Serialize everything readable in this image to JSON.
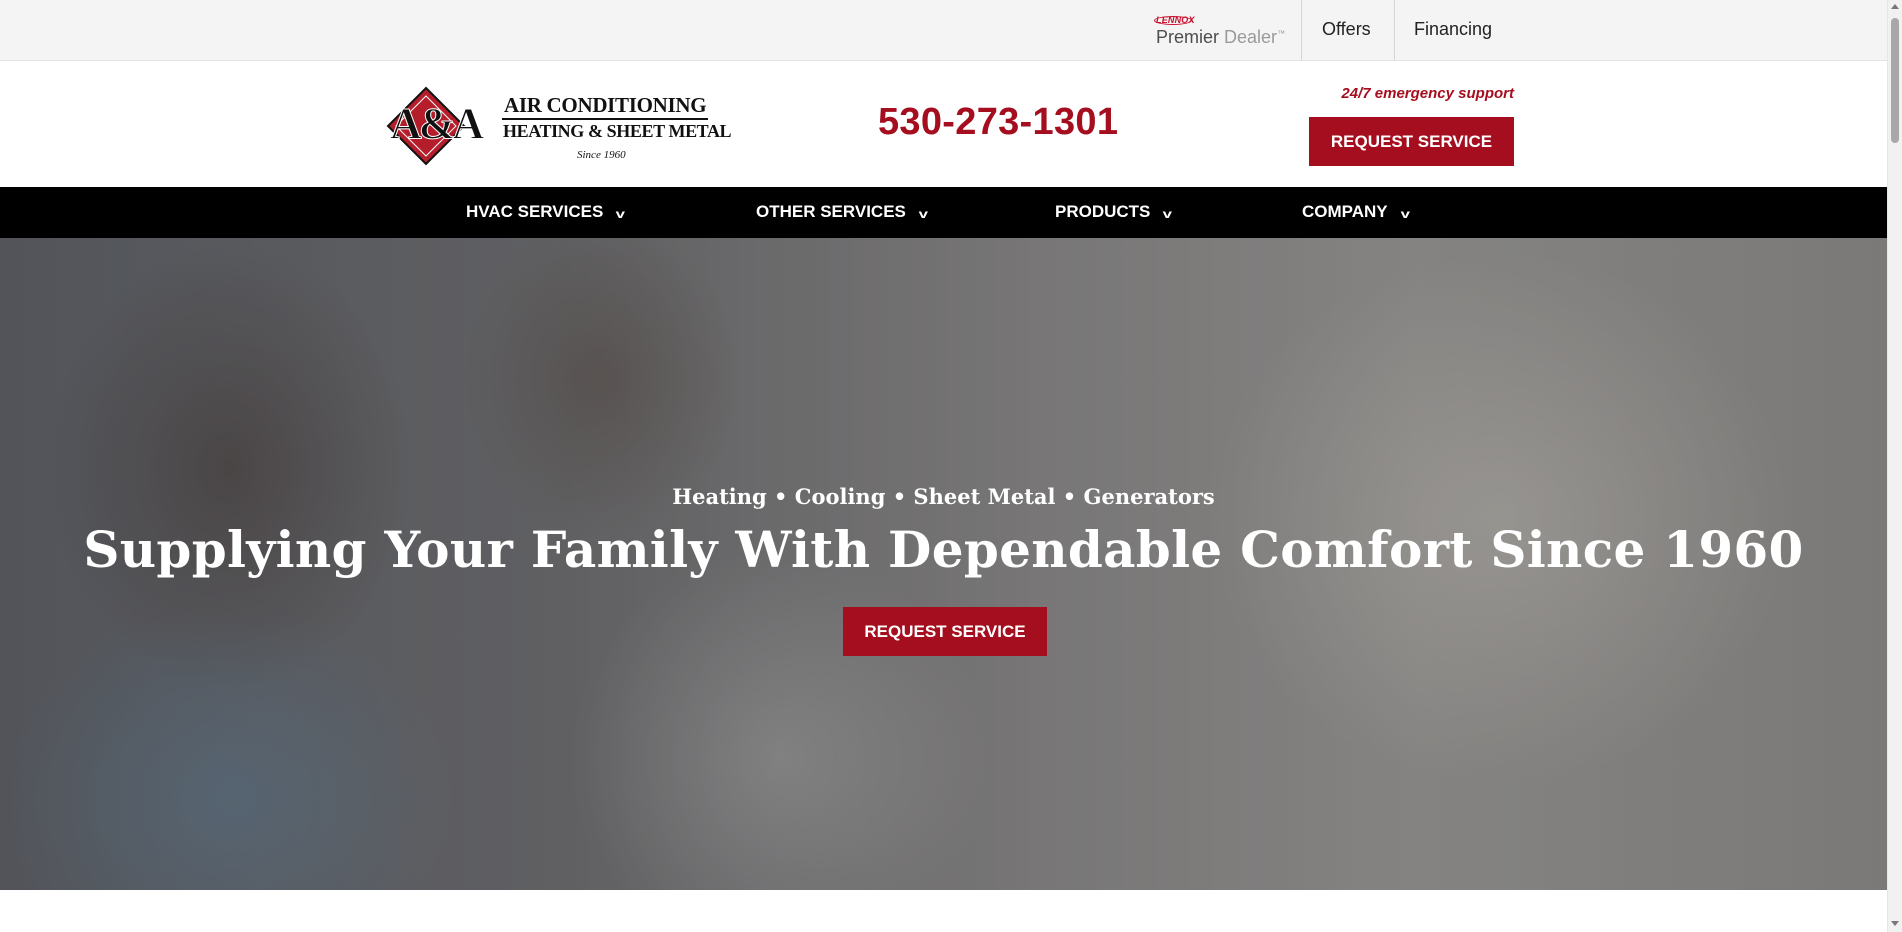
{
  "utility_bar": {
    "badge": {
      "brand": "LENNOX",
      "label_dark": "Premier",
      "label_light": "Dealer",
      "trademark": "™"
    },
    "links": [
      {
        "label": "Offers"
      },
      {
        "label": "Financing"
      }
    ]
  },
  "header": {
    "logo": {
      "monogram": "A&A",
      "line1": "AIR CONDITIONING",
      "line2": "HEATING & SHEET METAL",
      "since": "Since 1960",
      "diamond_since": "Since 1960"
    },
    "phone": "530-273-1301",
    "emergency": "24/7 emergency support",
    "cta": "REQUEST SERVICE"
  },
  "nav": {
    "items": [
      {
        "label": "HVAC SERVICES"
      },
      {
        "label": "OTHER SERVICES"
      },
      {
        "label": "PRODUCTS"
      },
      {
        "label": "COMPANY"
      }
    ]
  },
  "hero": {
    "subtitle": "Heating • Cooling • Sheet Metal • Generators",
    "title": "Supplying Your Family With Dependable Comfort Since 1960",
    "cta": "REQUEST SERVICE"
  },
  "colors": {
    "brand_red": "#a50e1e",
    "nav_bg": "#000000",
    "utility_bg": "#f4f4f4"
  },
  "icons": {
    "nav_dropdown": "chevron-down-icon"
  }
}
